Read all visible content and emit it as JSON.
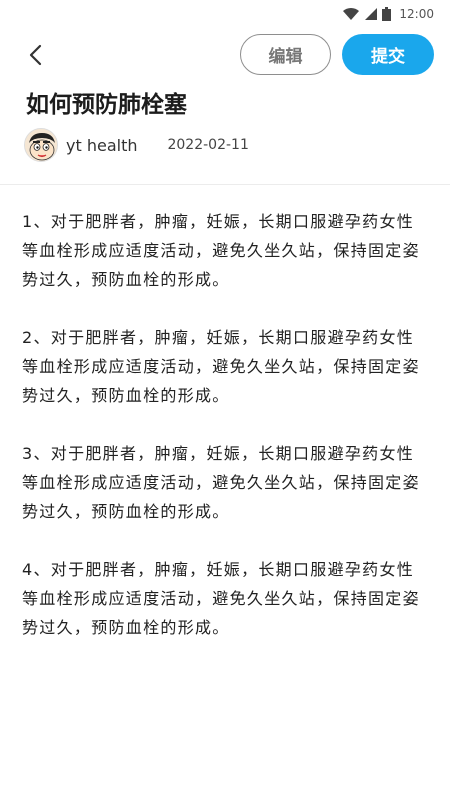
{
  "status_bar": {
    "time": "12:00"
  },
  "toolbar": {
    "edit_label": "编辑",
    "submit_label": "提交"
  },
  "article": {
    "title": "如何预防肺栓塞",
    "author": "yt health",
    "date": "2022-02-11",
    "paragraphs": [
      "1、对于肥胖者，肿瘤，妊娠，长期口服避孕药女性等血栓形成应适度活动，避免久坐久站，保持固定姿势过久，预防血栓的形成。",
      "2、对于肥胖者，肿瘤，妊娠，长期口服避孕药女性等血栓形成应适度活动，避免久坐久站，保持固定姿势过久，预防血栓的形成。",
      "3、对于肥胖者，肿瘤，妊娠，长期口服避孕药女性等血栓形成应适度活动，避免久坐久站，保持固定姿势过久，预防血栓的形成。",
      "4、对于肥胖者，肿瘤，妊娠，长期口服避孕药女性等血栓形成应适度活动，避免久坐久站，保持固定姿势过久，预防血栓的形成。"
    ]
  },
  "colors": {
    "accent": "#1aa7ec",
    "edit_border": "#8e8e8e"
  },
  "icons": {
    "back": "chevron-left-icon",
    "wifi": "wifi-icon",
    "signal": "signal-icon",
    "battery": "battery-icon"
  }
}
